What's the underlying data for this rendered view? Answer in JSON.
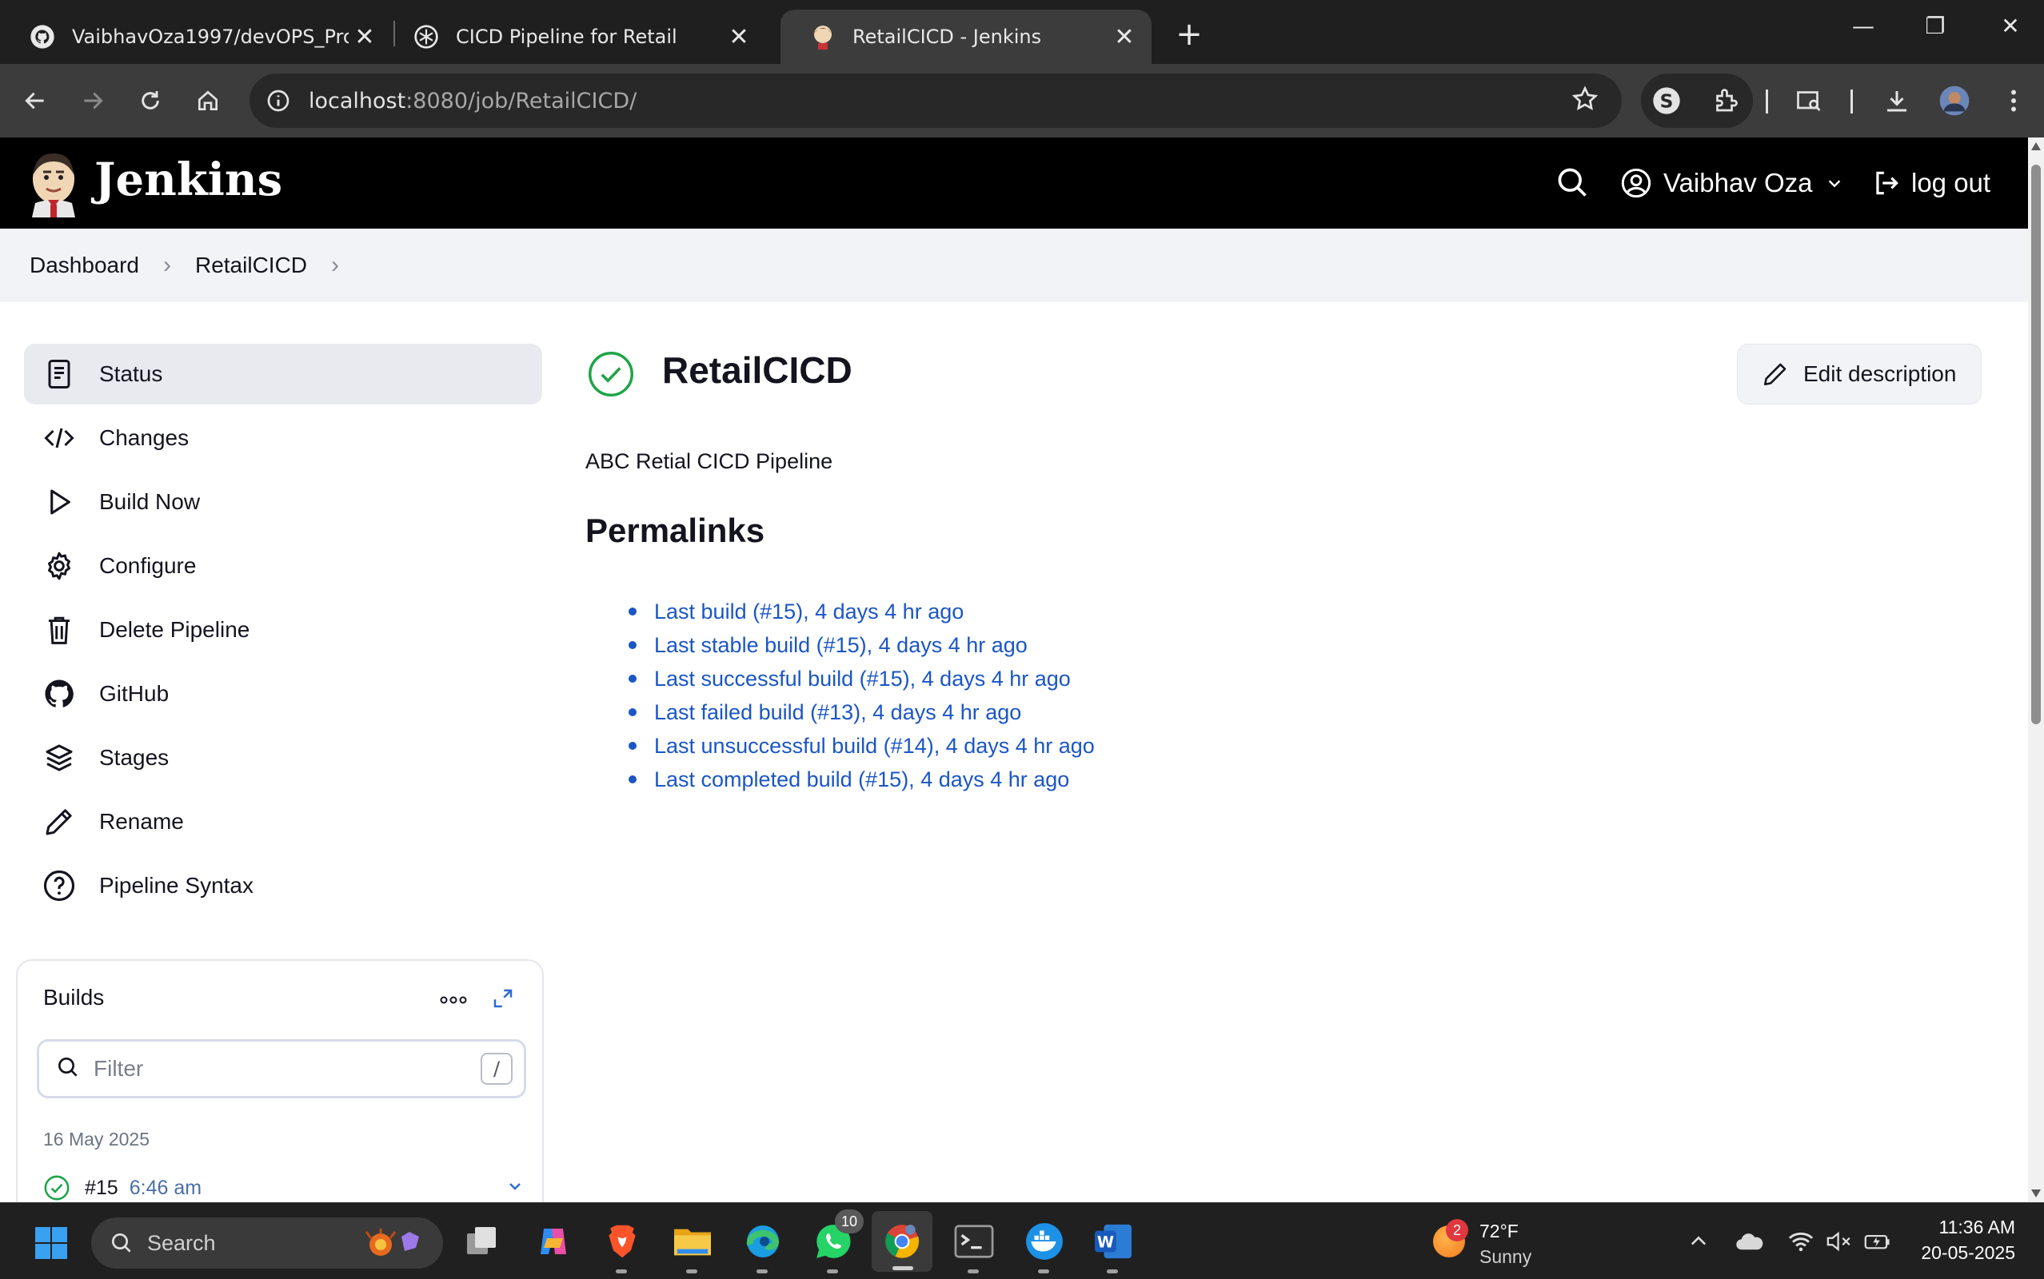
{
  "browser": {
    "tabs": [
      {
        "title": "VaibhavOza1997/devOPS_Proje",
        "icon": "github-icon"
      },
      {
        "title": "CICD Pipeline for Retail",
        "icon": "chatgpt-icon"
      },
      {
        "title": "RetailCICD - Jenkins",
        "icon": "jenkins-icon"
      }
    ],
    "url_host": "localhost",
    "url_rest": ":8080/job/RetailCICD/"
  },
  "header": {
    "brand": "Jenkins",
    "user_name": "Vaibhav Oza",
    "logout_label": "log out"
  },
  "breadcrumb": [
    {
      "label": "Dashboard"
    },
    {
      "label": "RetailCICD"
    }
  ],
  "side_panel": {
    "items": [
      {
        "label": "Status",
        "icon": "status-icon"
      },
      {
        "label": "Changes",
        "icon": "code-icon"
      },
      {
        "label": "Build Now",
        "icon": "play-icon"
      },
      {
        "label": "Configure",
        "icon": "gear-icon"
      },
      {
        "label": "Delete Pipeline",
        "icon": "trash-icon"
      },
      {
        "label": "GitHub",
        "icon": "github-icon"
      },
      {
        "label": "Stages",
        "icon": "layers-icon"
      },
      {
        "label": "Rename",
        "icon": "pencil-icon"
      },
      {
        "label": "Pipeline Syntax",
        "icon": "help-icon"
      }
    ]
  },
  "builds": {
    "title": "Builds",
    "filter_placeholder": "Filter",
    "filter_shortcut": "/",
    "date": "16 May 2025",
    "items": [
      {
        "number": "#15",
        "time": "6:46 am",
        "status": "success"
      }
    ]
  },
  "main": {
    "job_name": "RetailCICD",
    "edit_description_label": "Edit description",
    "description": "ABC Retial CICD Pipeline",
    "permalinks_title": "Permalinks",
    "permalinks": [
      "Last build (#15), 4 days 4 hr ago",
      "Last stable build (#15), 4 days 4 hr ago",
      "Last successful build (#15), 4 days 4 hr ago",
      "Last failed build (#13), 4 days 4 hr ago",
      "Last unsuccessful build (#14), 4 days 4 hr ago",
      "Last completed build (#15), 4 days 4 hr ago"
    ]
  },
  "taskbar": {
    "search_label": "Search",
    "whatsapp_badge": "10",
    "weather_badge": "2",
    "weather_temp": "72°F",
    "weather_condition": "Sunny",
    "time": "11:36 AM",
    "date": "20-05-2025"
  },
  "colors": {
    "link": "#1a56c6",
    "success": "#1ea446",
    "header_bg": "#000000",
    "breadcrumb_bg": "#f2f3f6"
  }
}
